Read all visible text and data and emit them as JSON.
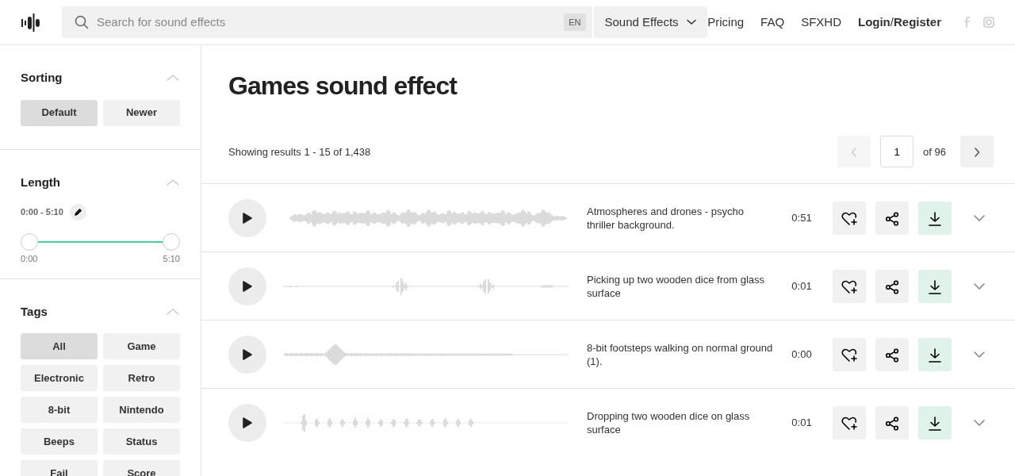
{
  "header": {
    "search": {
      "placeholder": "Search for sound effects"
    },
    "language": "EN",
    "category": "Sound Effects",
    "nav": [
      {
        "label": "Pricing"
      },
      {
        "label": "FAQ"
      },
      {
        "label": "SFXHD"
      },
      {
        "label": "**Login**/**Register**"
      }
    ]
  },
  "sidebar": {
    "sorting": {
      "title": "Sorting",
      "expanded": true,
      "options": [
        {
          "label": "Default",
          "selected": true
        },
        {
          "label": "Newer",
          "selected": false
        }
      ]
    },
    "length": {
      "title": "Length",
      "expanded": true,
      "range": "0:00 - 5:10",
      "low": {
        "level": 0
      },
      "high": {
        "level": 1
      },
      "min_label": "0:00",
      "max_label": "5:10"
    },
    "tags": {
      "title": "Tags",
      "expanded": true,
      "items": [
        {
          "label": "All",
          "selected": true
        },
        {
          "label": "Game",
          "selected": false
        },
        {
          "label": "Electronic",
          "selected": false
        },
        {
          "label": "Retro",
          "selected": false
        },
        {
          "label": "8-bit",
          "selected": false
        },
        {
          "label": "Nintendo",
          "selected": false
        },
        {
          "label": "Beeps",
          "selected": false
        },
        {
          "label": "Status",
          "selected": false
        },
        {
          "label": "Fail",
          "selected": false
        },
        {
          "label": "Score",
          "selected": false
        }
      ]
    }
  },
  "main": {
    "title": "Games sound effect",
    "results": "Showing results 1 - 15 of 1,438",
    "pagination": {
      "page": "1",
      "of": "of 96",
      "prev_disabled": true
    },
    "sounds": [
      {
        "title": "Atmospheres and drones - psycho thriller background.",
        "duration": "0:51"
      },
      {
        "title": "Picking up two wooden dice from glass surface",
        "duration": "0:01"
      },
      {
        "title": "8-bit footsteps walking on normal ground (1).",
        "duration": "0:00"
      },
      {
        "title": "Dropping two wooden dice on glass surface",
        "duration": "0:01"
      }
    ]
  }
}
